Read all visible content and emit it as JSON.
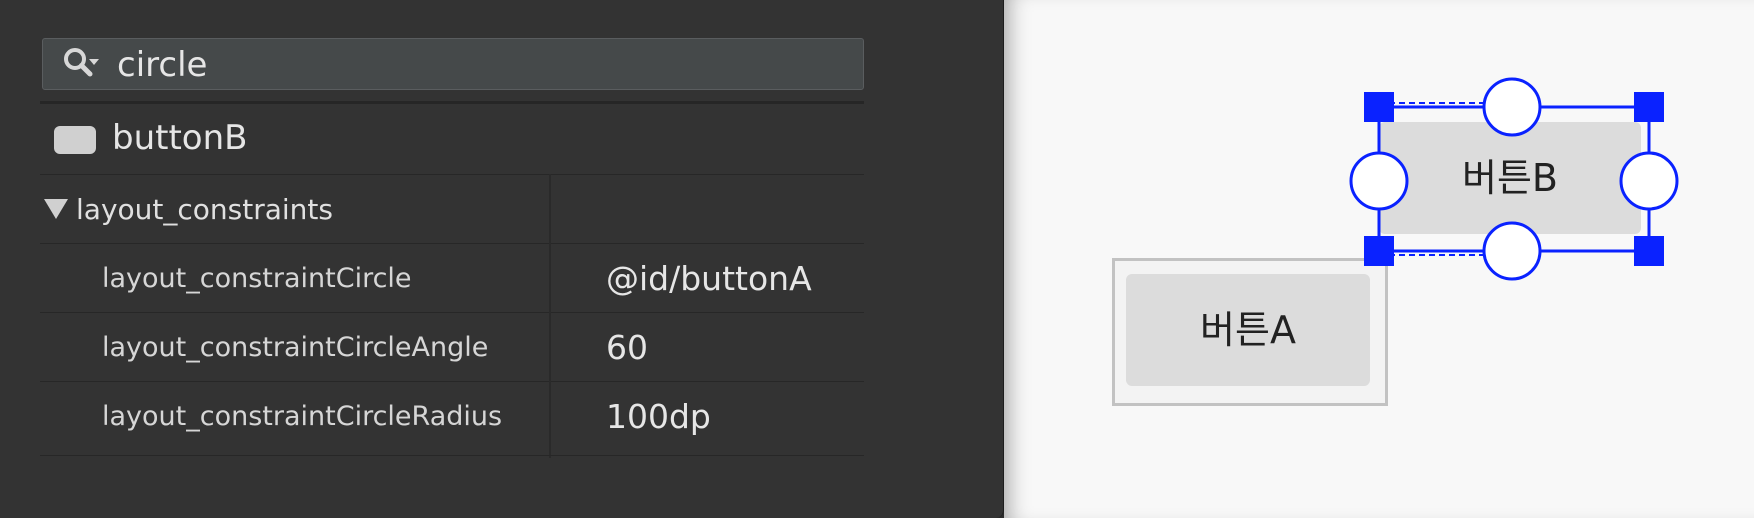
{
  "search": {
    "value": "circle",
    "placeholder": ""
  },
  "component": {
    "name": "buttonB"
  },
  "attributes": {
    "group": "layout_constraints",
    "rows": [
      {
        "name": "layout_constraintCircle",
        "value": "@id/buttonA"
      },
      {
        "name": "layout_constraintCircleAngle",
        "value": "60"
      },
      {
        "name": "layout_constraintCircleRadius",
        "value": "100dp"
      }
    ]
  },
  "canvas": {
    "button_a_label": "버튼A",
    "button_b_label": "버튼B"
  },
  "colors": {
    "panel_bg": "#333333",
    "selection": "#0a22ff",
    "canvas_bg": "#f8f8f8"
  }
}
